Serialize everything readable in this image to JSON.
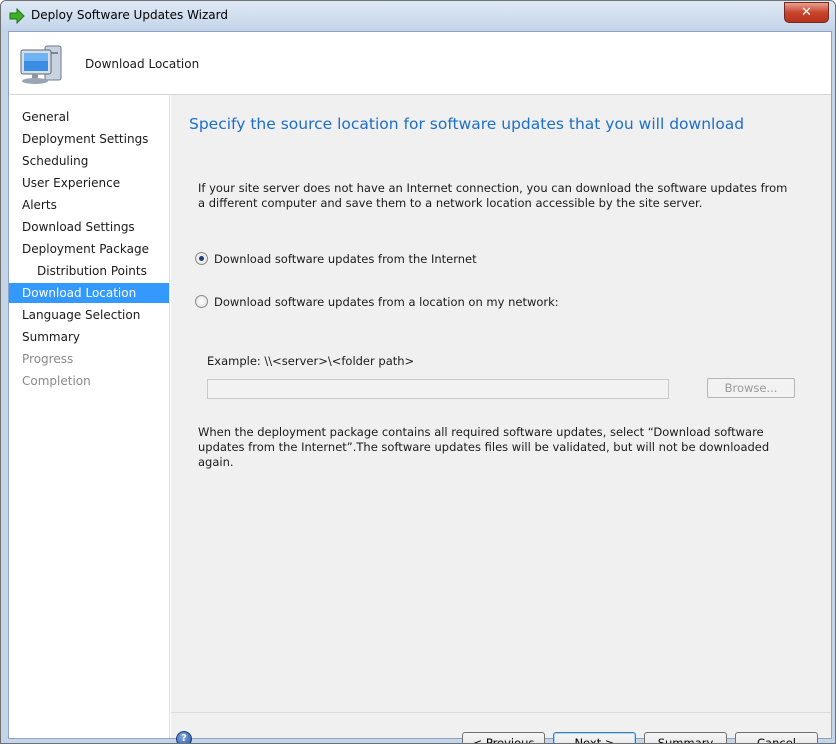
{
  "window": {
    "title": "Deploy Software Updates Wizard",
    "close_label": "✕"
  },
  "header": {
    "title": "Download Location",
    "icon": "computer-icon"
  },
  "nav": {
    "items": [
      {
        "label": "General",
        "state": "normal"
      },
      {
        "label": "Deployment Settings",
        "state": "normal"
      },
      {
        "label": "Scheduling",
        "state": "normal"
      },
      {
        "label": "User Experience",
        "state": "normal"
      },
      {
        "label": "Alerts",
        "state": "normal"
      },
      {
        "label": "Download Settings",
        "state": "normal"
      },
      {
        "label": "Deployment Package",
        "state": "normal"
      },
      {
        "label": "Distribution Points",
        "state": "sub"
      },
      {
        "label": "Download Location",
        "state": "active"
      },
      {
        "label": "Language Selection",
        "state": "normal"
      },
      {
        "label": "Summary",
        "state": "normal"
      },
      {
        "label": "Progress",
        "state": "disabled"
      },
      {
        "label": "Completion",
        "state": "disabled"
      }
    ]
  },
  "main": {
    "title": "Specify the source location for software updates that you will download",
    "description": "If your site server does not have an Internet connection, you can download the software updates from a different computer and save them to a network location accessible by the site server.",
    "option_internet": {
      "label": "Download software updates from the Internet",
      "checked": true
    },
    "option_network": {
      "label": "Download software updates from a location on my network:",
      "checked": false
    },
    "example": "Example: \\\\<server>\\<folder path>",
    "path_value": "",
    "browse_label": "Browse...",
    "note": "When the deployment package contains all required software updates, select “Download  software updates from the Internet”.The software updates files will be validated, but will not be downloaded again."
  },
  "footer": {
    "help_label": "?",
    "previous_label": "< Previous",
    "next_label": "Next >",
    "summary_label": "Summary",
    "cancel_label": "Cancel"
  },
  "colors": {
    "accent": "#3399ff",
    "title_text": "#1e6ec8",
    "content_bg": "#f0f0f0"
  }
}
